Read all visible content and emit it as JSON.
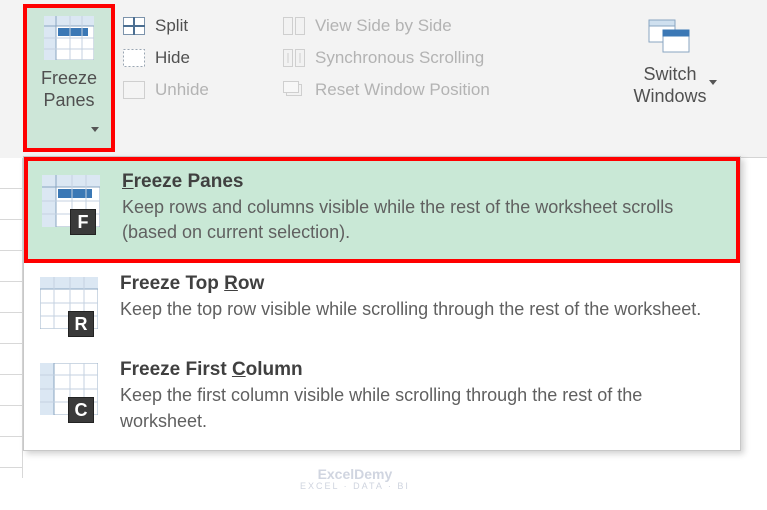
{
  "ribbon": {
    "freeze_panes_button": {
      "line1": "Freeze",
      "line2": "Panes"
    },
    "window_options": {
      "split": {
        "label": "Split",
        "enabled": true
      },
      "hide": {
        "label": "Hide",
        "enabled": true
      },
      "unhide": {
        "label": "Unhide",
        "enabled": false
      }
    },
    "side_options": {
      "view_side": {
        "label": "View Side by Side",
        "enabled": false
      },
      "sync_scroll": {
        "label": "Synchronous Scrolling",
        "enabled": false
      },
      "reset_window": {
        "label": "Reset Window Position",
        "enabled": false
      }
    },
    "switch_windows": {
      "line1": "Switch",
      "line2": "Windows"
    }
  },
  "dropdown": {
    "items": [
      {
        "key": "F",
        "title_pre": "",
        "title_u": "F",
        "title_post": "reeze Panes",
        "desc": "Keep rows and columns visible while the rest of the worksheet scrolls (based on current selection).",
        "highlight": true
      },
      {
        "key": "R",
        "title_pre": "Freeze Top ",
        "title_u": "R",
        "title_post": "ow",
        "desc": "Keep the top row visible while scrolling through the rest of the worksheet.",
        "highlight": false
      },
      {
        "key": "C",
        "title_pre": "Freeze First ",
        "title_u": "C",
        "title_post": "olumn",
        "desc": "Keep the first column visible while scrolling through the rest of the worksheet.",
        "highlight": false
      }
    ]
  },
  "watermark": {
    "name": "ExcelDemy",
    "tag": "EXCEL · DATA · BI"
  }
}
